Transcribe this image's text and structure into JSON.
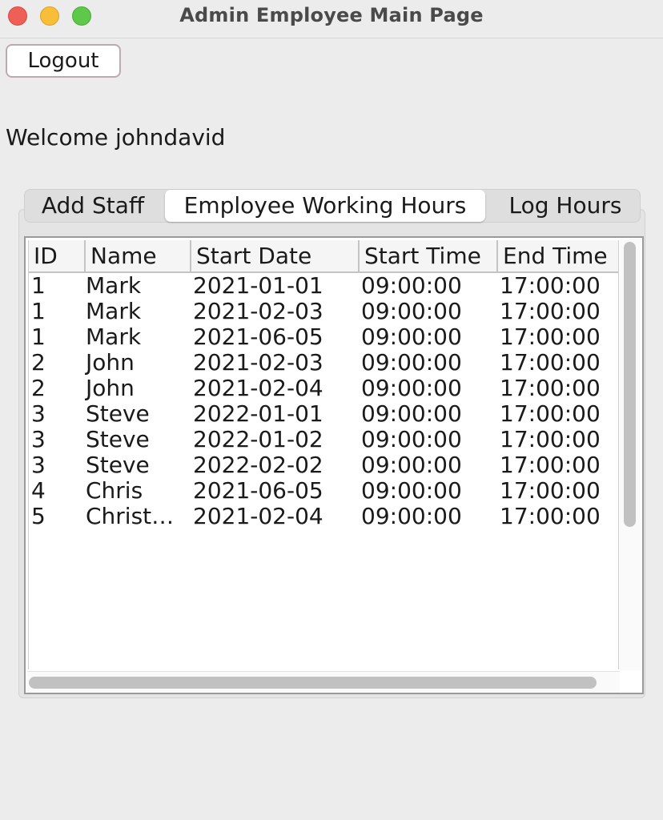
{
  "window": {
    "title": "Admin Employee Main Page"
  },
  "toolbar": {
    "logout_label": "Logout"
  },
  "welcome_text": "Welcome johndavid",
  "tabs": [
    {
      "label": "Add Staff",
      "selected": false
    },
    {
      "label": "Employee Working Hours",
      "selected": true
    },
    {
      "label": "Log Hours",
      "selected": false
    }
  ],
  "table": {
    "columns": [
      "ID",
      "Name",
      "Start Date",
      "Start Time",
      "End Time"
    ],
    "rows": [
      [
        "1",
        "Mark",
        "2021-01-01",
        "09:00:00",
        "17:00:00"
      ],
      [
        "1",
        "Mark",
        "2021-02-03",
        "09:00:00",
        "17:00:00"
      ],
      [
        "1",
        "Mark",
        "2021-06-05",
        "09:00:00",
        "17:00:00"
      ],
      [
        "2",
        "John",
        "2021-02-03",
        "09:00:00",
        "17:00:00"
      ],
      [
        "2",
        "John",
        "2021-02-04",
        "09:00:00",
        "17:00:00"
      ],
      [
        "3",
        "Steve",
        "2022-01-01",
        "09:00:00",
        "17:00:00"
      ],
      [
        "3",
        "Steve",
        "2022-01-02",
        "09:00:00",
        "17:00:00"
      ],
      [
        "3",
        "Steve",
        "2022-02-02",
        "09:00:00",
        "17:00:00"
      ],
      [
        "4",
        "Chris",
        "2021-06-05",
        "09:00:00",
        "17:00:00"
      ],
      [
        "5",
        "Christ…",
        "2021-02-04",
        "09:00:00",
        "17:00:00"
      ]
    ]
  },
  "colors": {
    "window_bg": "#ececec",
    "close": "#ee5f58",
    "minimize": "#f8be3a",
    "maximize": "#5ec84a"
  }
}
